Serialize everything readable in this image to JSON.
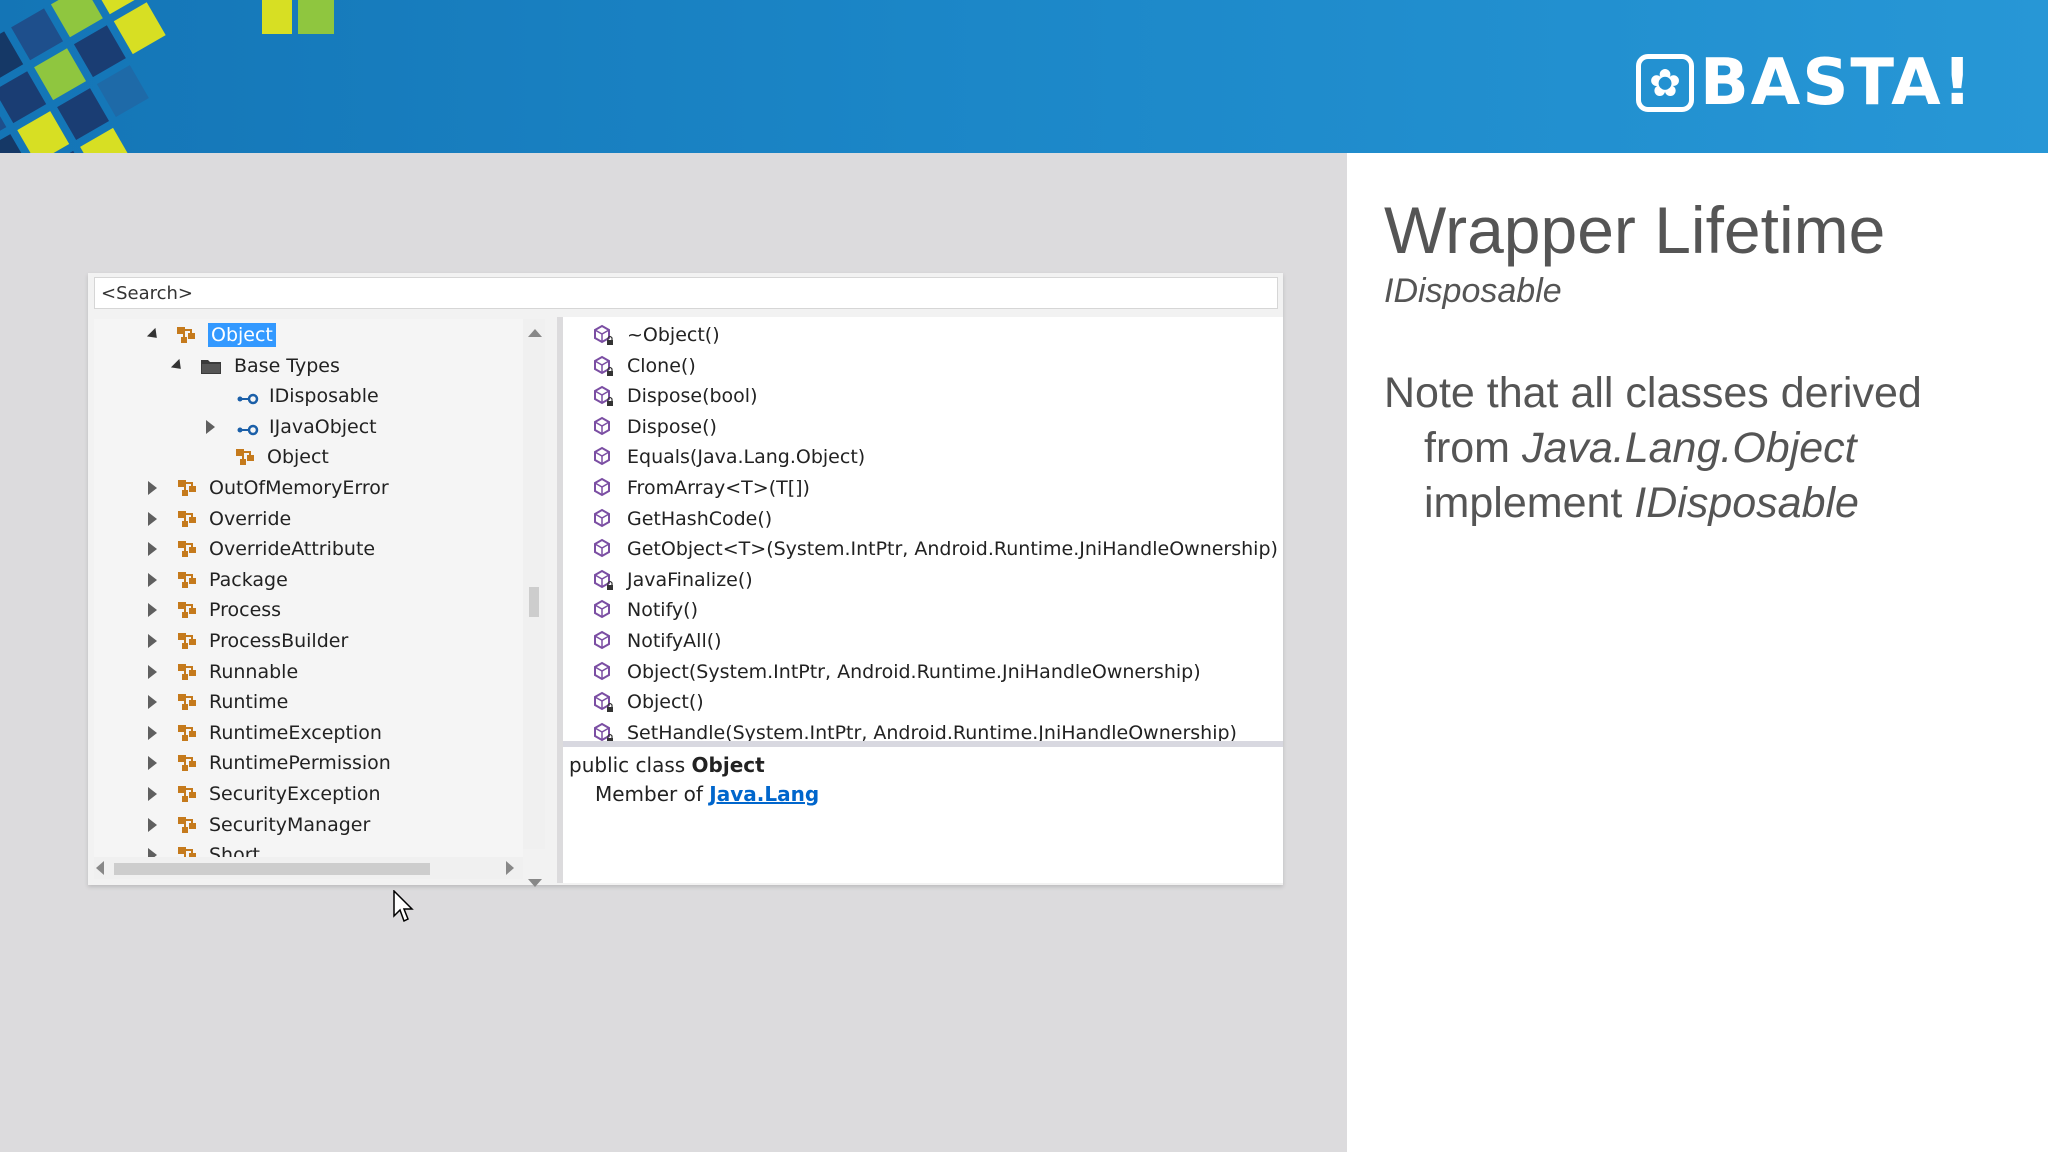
{
  "banner": {
    "logo_text": "BASTA!",
    "colors": {
      "background": "#1b86c7",
      "deco_dark": "#1a3d73",
      "deco_green": "#8fc63f",
      "deco_yellow": "#d7df23"
    }
  },
  "slide": {
    "title": "Wrapper Lifetime",
    "subtitle": "IDisposable",
    "note_line1": "Note that all classes derived",
    "note_line2_prefix": "from ",
    "note_line2_italic": "Java.Lang.Object",
    "note_line3_prefix": "implement ",
    "note_line3_italic": "IDisposable"
  },
  "object_browser": {
    "search_placeholder": "<Search>",
    "tree": [
      {
        "label": "Object",
        "expander": "open",
        "icon": "class-icon",
        "selected": true
      },
      {
        "label": "Base Types",
        "expander": "open",
        "icon": "folder-icon"
      },
      {
        "label": "IDisposable",
        "expander": "none",
        "icon": "interface-icon"
      },
      {
        "label": "IJavaObject",
        "expander": "closed",
        "icon": "interface-icon"
      },
      {
        "label": "Object",
        "expander": "none",
        "icon": "class-icon"
      },
      {
        "label": "OutOfMemoryError",
        "expander": "closed",
        "icon": "class-icon"
      },
      {
        "label": "Override",
        "expander": "closed",
        "icon": "class-icon"
      },
      {
        "label": "OverrideAttribute",
        "expander": "closed",
        "icon": "class-icon"
      },
      {
        "label": "Package",
        "expander": "closed",
        "icon": "class-icon"
      },
      {
        "label": "Process",
        "expander": "closed",
        "icon": "class-icon"
      },
      {
        "label": "ProcessBuilder",
        "expander": "closed",
        "icon": "class-icon"
      },
      {
        "label": "Runnable",
        "expander": "closed",
        "icon": "class-icon"
      },
      {
        "label": "Runtime",
        "expander": "closed",
        "icon": "class-icon"
      },
      {
        "label": "RuntimeException",
        "expander": "closed",
        "icon": "class-icon"
      },
      {
        "label": "RuntimePermission",
        "expander": "closed",
        "icon": "class-icon"
      },
      {
        "label": "SecurityException",
        "expander": "closed",
        "icon": "class-icon"
      },
      {
        "label": "SecurityManager",
        "expander": "closed",
        "icon": "class-icon"
      },
      {
        "label": "Short",
        "expander": "closed",
        "icon": "class-icon"
      }
    ],
    "members": [
      {
        "label": "~Object()",
        "protected": true
      },
      {
        "label": "Clone()",
        "protected": true
      },
      {
        "label": "Dispose(bool)",
        "protected": true
      },
      {
        "label": "Dispose()",
        "protected": false
      },
      {
        "label": "Equals(Java.Lang.Object)",
        "protected": false
      },
      {
        "label": "FromArray<T>(T[])",
        "protected": false
      },
      {
        "label": "GetHashCode()",
        "protected": false
      },
      {
        "label": "GetObject<T>(System.IntPtr, Android.Runtime.JniHandleOwnership)",
        "protected": false
      },
      {
        "label": "JavaFinalize()",
        "protected": true
      },
      {
        "label": "Notify()",
        "protected": false
      },
      {
        "label": "NotifyAll()",
        "protected": false
      },
      {
        "label": "Object(System.IntPtr, Android.Runtime.JniHandleOwnership)",
        "protected": false
      },
      {
        "label": "Object()",
        "protected": true
      },
      {
        "label": "SetHandle(System.IntPtr, Android.Runtime.JniHandleOwnership)",
        "protected": true
      }
    ],
    "details": {
      "decl_prefix": "public class ",
      "decl_name": "Object",
      "member_of_prefix": "Member of ",
      "member_of_link": "Java.Lang"
    },
    "colors": {
      "selection": "#3399ff",
      "class_icon": "#c57a1c",
      "interface_icon": "#1b5fa8",
      "method_icon": "#7b4ea3",
      "link": "#0066cc"
    }
  }
}
